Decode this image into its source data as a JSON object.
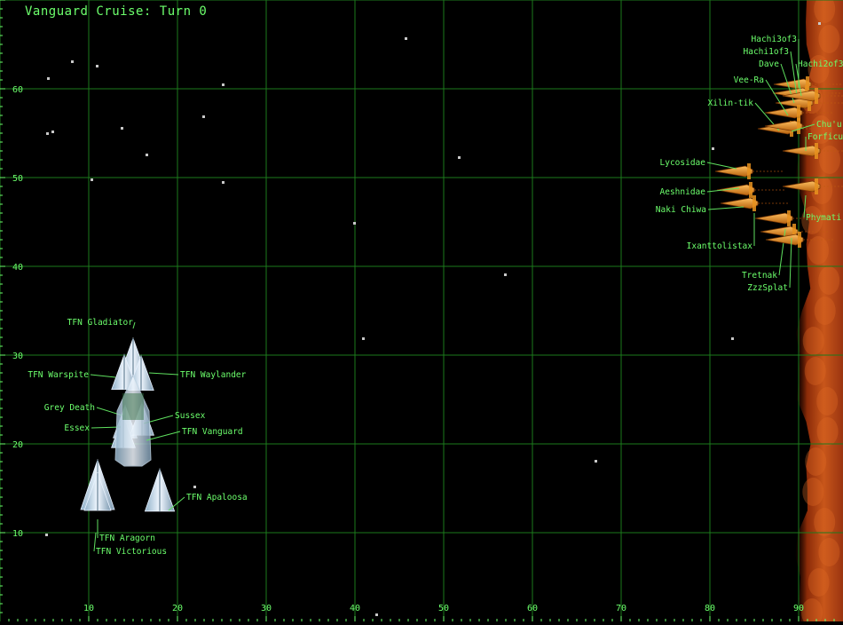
{
  "title": "Vanguard Cruise: Turn 0",
  "colors": {
    "background": "#000000",
    "grid": "#1c7a1c",
    "label": "#6cff6c",
    "tick": "#6cff6c",
    "leader": "#5fe05f",
    "star": "#c8c8c8",
    "nebula": "#c04a12",
    "terran_ship": "#d8e6f0",
    "alien_ship": "#e8921e"
  },
  "axes": {
    "x_ticks": [
      "10",
      "20",
      "30",
      "40",
      "50",
      "60",
      "70",
      "80",
      "90"
    ],
    "y_ticks": [
      "10",
      "20",
      "30",
      "40",
      "50",
      "60"
    ]
  },
  "stars": [
    {
      "x": 5.4,
      "y": 61.2
    },
    {
      "x": 8.1,
      "y": 63.1
    },
    {
      "x": 10.9,
      "y": 62.6
    },
    {
      "x": 5.3,
      "y": 55.0
    },
    {
      "x": 5.9,
      "y": 55.2
    },
    {
      "x": 13.7,
      "y": 55.6
    },
    {
      "x": 16.5,
      "y": 52.6
    },
    {
      "x": 10.3,
      "y": 49.8
    },
    {
      "x": 22.9,
      "y": 56.9
    },
    {
      "x": 25.1,
      "y": 60.5
    },
    {
      "x": 25.1,
      "y": 49.5
    },
    {
      "x": 45.7,
      "y": 65.7
    },
    {
      "x": 51.7,
      "y": 52.3
    },
    {
      "x": 39.9,
      "y": 44.9
    },
    {
      "x": 56.9,
      "y": 39.1
    },
    {
      "x": 40.9,
      "y": 31.9
    },
    {
      "x": 82.5,
      "y": 31.9
    },
    {
      "x": 80.3,
      "y": 53.3
    },
    {
      "x": 67.1,
      "y": 18.1
    },
    {
      "x": 21.9,
      "y": 15.2
    },
    {
      "x": 5.2,
      "y": 9.8
    },
    {
      "x": 42.4,
      "y": 0.8
    },
    {
      "x": 92.3,
      "y": 67.4
    }
  ],
  "terran_fleet": [
    {
      "name": "TFN Gladiator",
      "x": 15.0,
      "y": 29.8,
      "scale": 1.0
    },
    {
      "name": "TFN Warspite",
      "x": 14.0,
      "y": 28.1,
      "scale": 0.9
    },
    {
      "name": "TFN Waylander",
      "x": 15.9,
      "y": 28.0,
      "scale": 0.9
    },
    {
      "name": "Grey Death",
      "x": 14.1,
      "y": 22.5,
      "scale": 0.8
    },
    {
      "name": "Sussex",
      "x": 16.0,
      "y": 22.8,
      "scale": 0.8
    },
    {
      "name": "Essex",
      "x": 13.9,
      "y": 21.4,
      "scale": 0.8
    },
    {
      "name": "TFN Vanguard",
      "x": 15.0,
      "y": 20.7,
      "scale": 2.0
    },
    {
      "name": "TFN Aragorn",
      "x": 11.0,
      "y": 15.4,
      "scale": 1.5
    },
    {
      "name": "TFN Victorious",
      "x": 11.0,
      "y": 14.6,
      "scale": 1.0
    },
    {
      "name": "TFN Apaloosa",
      "x": 18.0,
      "y": 14.8,
      "scale": 1.2
    }
  ],
  "alien_fleet": [
    {
      "name": "Hachi3of3",
      "x": 90.0,
      "y": 60.5
    },
    {
      "name": "Hachi1of3",
      "x": 89.9,
      "y": 59.5
    },
    {
      "name": "Dave",
      "x": 90.2,
      "y": 58.4
    },
    {
      "name": "Hachi2of3",
      "x": 91.0,
      "y": 59.2
    },
    {
      "name": "Vee-Ra",
      "x": 89.0,
      "y": 57.3
    },
    {
      "name": "Xilin-tik",
      "x": 88.2,
      "y": 55.5
    },
    {
      "name": "Chu'u",
      "x": 89.0,
      "y": 55.8
    },
    {
      "name": "Forficu",
      "x": 91.0,
      "y": 53.0
    },
    {
      "name": "Lycosidae",
      "x": 83.4,
      "y": 50.7
    },
    {
      "name": "Aeshnidae",
      "x": 83.6,
      "y": 48.6
    },
    {
      "name": "Naki Chiwa",
      "x": 84.0,
      "y": 47.1
    },
    {
      "name": "Phymati",
      "x": 91.0,
      "y": 49.0
    },
    {
      "name": "Ixanttolistax",
      "x": 87.9,
      "y": 45.4
    },
    {
      "name": "Tretnak",
      "x": 88.5,
      "y": 43.9
    },
    {
      "name": "ZzzSplat",
      "x": 89.1,
      "y": 43.0
    }
  ]
}
